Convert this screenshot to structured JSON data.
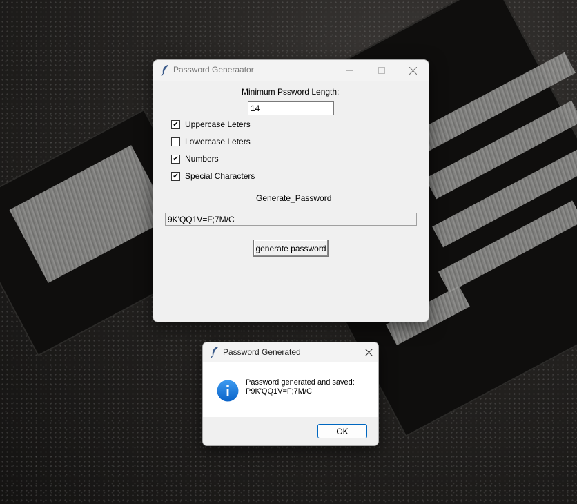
{
  "main_window": {
    "title": "Password Generaator",
    "min_length_label": "Minimum Pssword Length:",
    "min_length_value": "14",
    "options": [
      {
        "label": "Uppercase Leters",
        "checked": true
      },
      {
        "label": "Lowercase Leters",
        "checked": false
      },
      {
        "label": "Numbers",
        "checked": true
      },
      {
        "label": "Special Characters",
        "checked": true
      }
    ],
    "generated_label": "Generate_Password",
    "generated_value": "9K'QQ1V=F;7M/C",
    "generate_button": "generate password",
    "icons": {
      "app": "feather-icon",
      "minimize": "minimize-icon",
      "maximize": "maximize-icon",
      "close": "close-icon"
    }
  },
  "dialog": {
    "title": "Password Generated",
    "message_line1": "Password generated and saved:",
    "message_line2": "P9K'QQ1V=F;7M/C",
    "ok_button": "OK",
    "icons": {
      "info": "info-icon",
      "close": "close-icon"
    }
  },
  "colors": {
    "window_bg": "#f0f0f0",
    "info_blue": "#1a73e8",
    "ok_border": "#0067c0"
  }
}
